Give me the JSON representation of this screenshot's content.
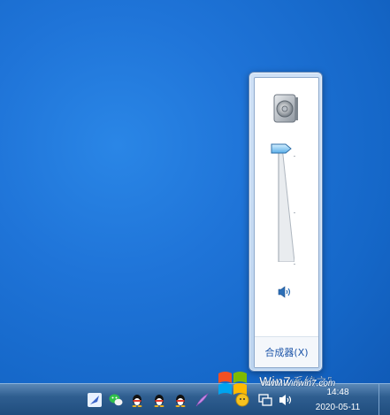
{
  "flyout": {
    "volume_percent": 100,
    "mixer_label": "合成器(X)"
  },
  "taskbar": {
    "clock": {
      "time": "14:48",
      "date": "2020-05-11"
    },
    "tray_icons": [
      "feather-icon",
      "wechat-icon",
      "qq-icon",
      "qq-icon",
      "qq-icon",
      "quill-icon",
      "windows-flag-icon",
      "messenger-icon",
      "network-icon",
      "volume-icon"
    ]
  },
  "watermark": {
    "text": "Win7系统之家",
    "url_text": "www.Winwin7.com"
  }
}
